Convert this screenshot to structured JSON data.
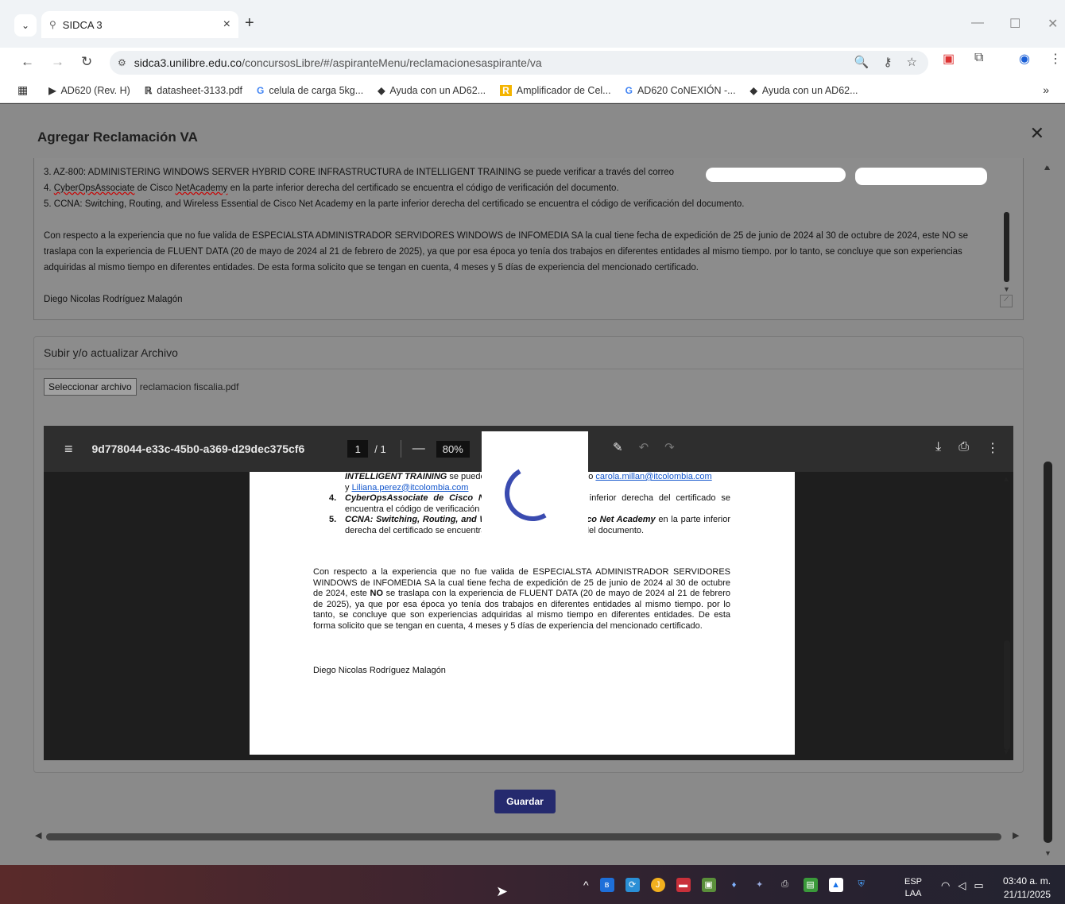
{
  "browser": {
    "tab_title": "SIDCA 3",
    "url_host": "sidca3.unilibre.edu.co",
    "url_path": "/concursosLibre/#/aspiranteMenu/reclamacionesaspirante/va",
    "bookmarks": [
      "AD620 (Rev. H)",
      "datasheet-3133.pdf",
      "celula de carga 5kg...",
      "Ayuda con un AD62...",
      "Amplificador de Cel...",
      "AD620 CoNEXIÓN -...",
      "Ayuda con un AD62..."
    ]
  },
  "dialog": {
    "title": "Agregar Reclamación VA",
    "textarea_lines": {
      "item3": "3.   AZ-800: ADMINISTERING WINDOWS SERVER HYBRID CORE INFRASTRUCTURA de INTELLIGENT TRAINING se puede verificar a través del correo",
      "item3_y": "y",
      "item4_a": "4.   ",
      "item4_b": "CyberOpsAssociate",
      "item4_c": " de Cisco ",
      "item4_d": "NetAcademy",
      "item4_e": " en la parte inferior derecha del certificado se encuentra el código de verificación del documento.",
      "item5": "5.   CCNA: Switching, Routing, and Wireless Essential de Cisco Net Academy en la parte inferior derecha del certificado se encuentra el código de verificación del documento.",
      "para": "Con respecto a la experiencia que no fue valida de ESPECIALSTA ADMINISTRADOR SERVIDORES WINDOWS de INFOMEDIA SA la cual tiene fecha de expedición de 25 de junio de 2024 al 30 de octubre de 2024, este NO se traslapa con la experiencia de FLUENT DATA (20 de mayo de 2024 al 21 de febrero de 2025), ya que por esa época yo tenía dos trabajos en diferentes entidades al mismo tiempo. por lo tanto, se concluye que son experiencias adquiridas al mismo tiempo en diferentes entidades. De esta forma solicito que se tengan en cuenta, 4 meses y 5 días de experiencia del mencionado certificado.",
      "signature": "Diego Nicolas Rodríguez Malagón"
    },
    "upload": {
      "title": "Subir y/o actualizar Archivo",
      "button": "Seleccionar archivo",
      "filename": "reclamacion fiscalia.pdf"
    },
    "pdf": {
      "name": "9d778044-e33c-45b0-a369-d29dec375cf6",
      "page": "1",
      "total": "/ 1",
      "zoom": "80%",
      "line1_b": "INTELLIGENT TRAINING",
      "line1_r": " se puede verificar a través del correo ",
      "email1": "carola.millan@itcolombia.com",
      "line2_y": "y ",
      "email2": "Liliana.perez@itcolombia.com",
      "item4_num": "4.",
      "item4_b": "CyberOpsAssociate de Cisco NetAcademy",
      "item4_r": " en la parte inferior derecha del certificado se encuentra el código de verificación del documento.",
      "item5_num": "5.",
      "item5_b": "CCNA: Switching, Routing, and Wireless Essential de Cisco Net Academy",
      "item5_r": " en la parte inferior derecha del certificado se encuentra el código de verificación del documento.",
      "para_a": "Con respecto a la experiencia que no fue valida de ESPECIALSTA ADMINISTRADOR SERVIDORES WINDOWS de INFOMEDIA SA la cual tiene fecha de expedición de 25 de junio de 2024 al 30 de octubre de 2024, este ",
      "para_no": "NO",
      "para_b": " se traslapa con la experiencia de FLUENT DATA (20 de mayo de 2024 al 21 de febrero de 2025), ya que por esa época yo tenía dos trabajos en diferentes entidades al mismo tiempo. por lo tanto, se concluye que son experiencias adquiridas al mismo tiempo en diferentes entidades. De esta forma solicito que se tengan en cuenta, 4 meses y 5 días de experiencia del mencionado certificado.",
      "signature": "Diego Nicolas Rodríguez Malagón"
    },
    "save_label": "Guardar"
  },
  "taskbar": {
    "lang_top": "ESP",
    "lang_bottom": "LAA",
    "time": "03:40 a. m.",
    "date": "21/11/2025"
  },
  "colors": {
    "accent": "#252a6e",
    "spinner": "#3a4bb0"
  }
}
